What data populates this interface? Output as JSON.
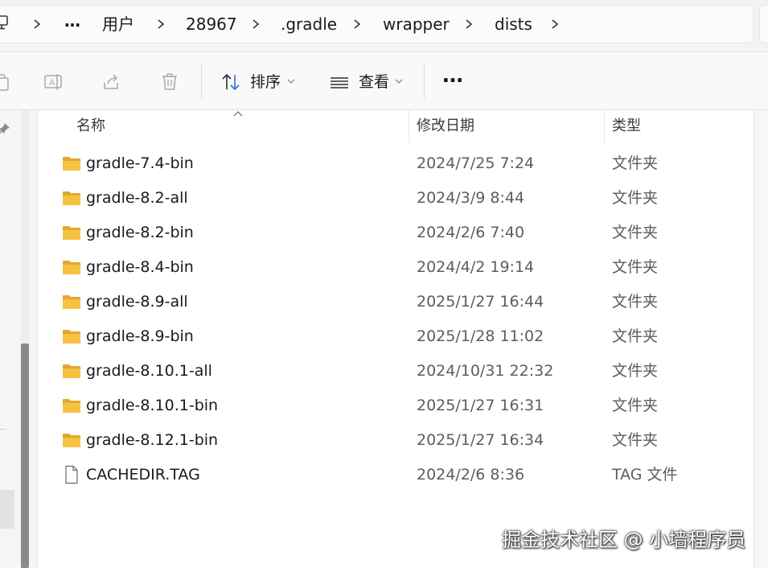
{
  "breadcrumb": {
    "overflow_label": "…",
    "items": [
      "用户",
      "28967",
      ".gradle",
      "wrapper",
      "dists"
    ]
  },
  "toolbar": {
    "sort_label": "排序",
    "view_label": "查看",
    "more_label": "…"
  },
  "columns": {
    "name": "名称",
    "date": "修改日期",
    "type": "类型"
  },
  "files": [
    {
      "name": "gradle-7.4-bin",
      "date": "2024/7/25 7:24",
      "type": "文件夹",
      "kind": "folder"
    },
    {
      "name": "gradle-8.2-all",
      "date": "2024/3/9 8:44",
      "type": "文件夹",
      "kind": "folder"
    },
    {
      "name": "gradle-8.2-bin",
      "date": "2024/2/6 7:40",
      "type": "文件夹",
      "kind": "folder"
    },
    {
      "name": "gradle-8.4-bin",
      "date": "2024/4/2 19:14",
      "type": "文件夹",
      "kind": "folder"
    },
    {
      "name": "gradle-8.9-all",
      "date": "2025/1/27 16:44",
      "type": "文件夹",
      "kind": "folder"
    },
    {
      "name": "gradle-8.9-bin",
      "date": "2025/1/28 11:02",
      "type": "文件夹",
      "kind": "folder"
    },
    {
      "name": "gradle-8.10.1-all",
      "date": "2024/10/31 22:32",
      "type": "文件夹",
      "kind": "folder"
    },
    {
      "name": "gradle-8.10.1-bin",
      "date": "2025/1/27 16:31",
      "type": "文件夹",
      "kind": "folder"
    },
    {
      "name": "gradle-8.12.1-bin",
      "date": "2025/1/27 16:34",
      "type": "文件夹",
      "kind": "folder"
    },
    {
      "name": "CACHEDIR.TAG",
      "date": "2024/2/6 8:36",
      "type": "TAG 文件",
      "kind": "file"
    }
  ],
  "watermark": "掘金技术社区 @ 小墙程序员",
  "colors": {
    "folder": "#f5c242",
    "icon_gray": "#9a9a9a",
    "accent": "#2a6fd6"
  },
  "icons": {
    "pc": "computer-icon",
    "copy": "copy-icon",
    "rename": "rename-icon",
    "share": "share-icon",
    "delete": "trash-icon",
    "sort": "sort-arrows-icon",
    "view": "view-lines-icon",
    "pin": "pin-icon",
    "folder": "folder-icon",
    "file": "file-icon"
  }
}
